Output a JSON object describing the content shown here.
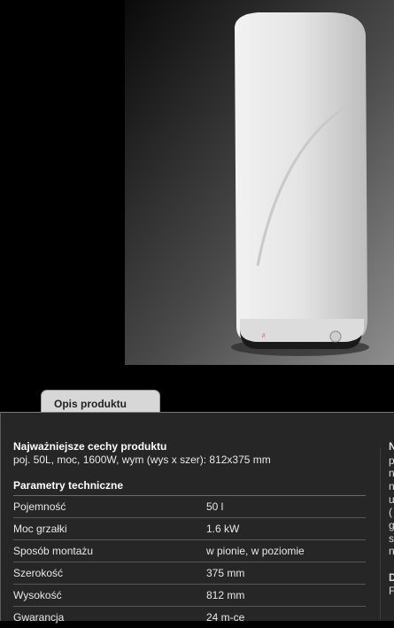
{
  "tab": {
    "label": "Opis produktu"
  },
  "features": {
    "heading": "Najważniejsze cechy produktu",
    "summary": "poj. 50L, moc, 1600W, wym (wys x szer): 812x375 mm"
  },
  "params": {
    "heading": "Parametry techniczne",
    "rows": [
      {
        "key": "Pojemność",
        "value": "50 l"
      },
      {
        "key": "Moc grzałki",
        "value": "1.6 kW"
      },
      {
        "key": "Sposób montażu",
        "value": "w pionie, w poziomie"
      },
      {
        "key": "Szerokość",
        "value": "375 mm"
      },
      {
        "key": "Wysokość",
        "value": "812 mm"
      },
      {
        "key": "Gwarancja",
        "value": "24 m-ce"
      }
    ]
  },
  "right_column_fragments": {
    "heading_1": "N",
    "lines_1": [
      "p",
      "n",
      "n",
      "u",
      "(",
      "g",
      "s",
      "n"
    ],
    "heading_2": "D",
    "lines_2": [
      "F"
    ]
  }
}
